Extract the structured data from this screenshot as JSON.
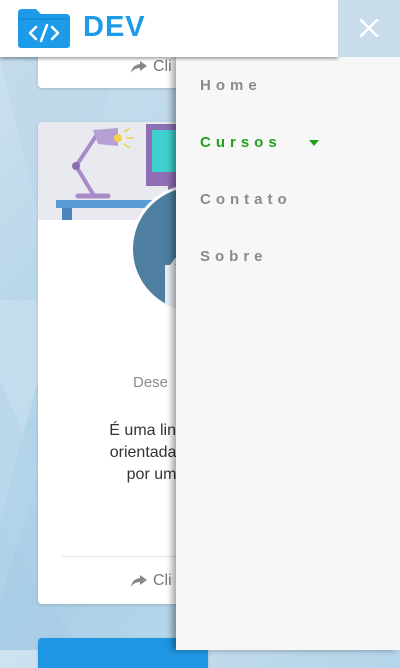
{
  "header": {
    "logo_text": "DEV",
    "logo_icon": "code-folder-icon",
    "close_icon": "close-icon"
  },
  "side_menu": {
    "items": [
      {
        "label": "Home",
        "active": false
      },
      {
        "label": "Cursos",
        "active": true,
        "has_dropdown": true
      },
      {
        "label": "Contato",
        "active": false
      },
      {
        "label": "Sobre",
        "active": false
      }
    ]
  },
  "cards": {
    "top_card_link": "Cli",
    "main_card": {
      "title": "Dese",
      "description_lines": [
        "É uma lingua",
        "orientada a c",
        "por uma"
      ],
      "link_label": "Cli"
    }
  },
  "colors": {
    "brand": "#1e9be8",
    "active_menu": "#22a11f",
    "menu_text": "#8a8a8a",
    "close_bg": "#c8dcea"
  }
}
